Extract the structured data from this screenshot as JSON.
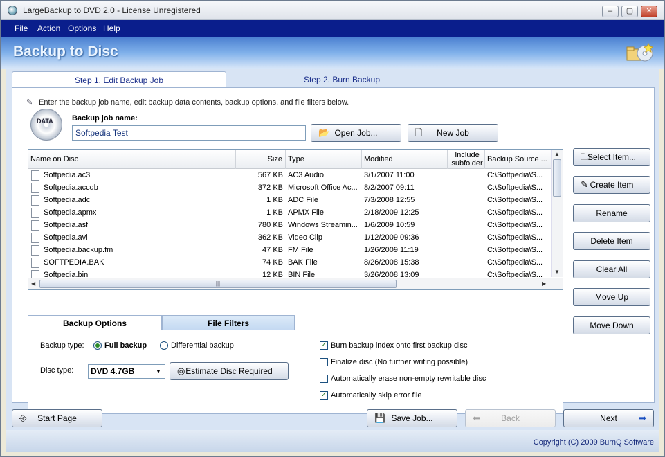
{
  "window": {
    "title": "LargeBackup to DVD 2.0 - License Unregistered",
    "min": "–",
    "max": "▢",
    "close": "✕"
  },
  "menu": [
    "File",
    "Action",
    "Options",
    "Help"
  ],
  "header": {
    "title": "Backup to Disc"
  },
  "steps": {
    "step1": "Step 1. Edit Backup Job",
    "step2": "Step 2. Burn Backup"
  },
  "hint": "Enter the backup job name, edit backup data contents, backup options, and file filters below.",
  "job": {
    "logo_text": "DATA",
    "label": "Backup job name:",
    "value": "Softpedia Test",
    "open_label": "Open Job...",
    "new_label": "New Job"
  },
  "list": {
    "columns": [
      "Name on Disc",
      "Size",
      "Type",
      "Modified",
      "Include subfolder",
      "Backup Source ..."
    ],
    "rows": [
      {
        "name": "Softpedia.ac3",
        "size": "567 KB",
        "type": "AC3 Audio",
        "modified": "3/1/2007 11:00",
        "source": "C:\\Softpedia\\S..."
      },
      {
        "name": "Softpedia.accdb",
        "size": "372 KB",
        "type": "Microsoft Office Ac...",
        "modified": "8/2/2007 09:11",
        "source": "C:\\Softpedia\\S..."
      },
      {
        "name": "Softpedia.adc",
        "size": "1 KB",
        "type": "ADC File",
        "modified": "7/3/2008 12:55",
        "source": "C:\\Softpedia\\S..."
      },
      {
        "name": "Softpedia.apmx",
        "size": "1 KB",
        "type": "APMX File",
        "modified": "2/18/2009 12:25",
        "source": "C:\\Softpedia\\S..."
      },
      {
        "name": "Softpedia.asf",
        "size": "780 KB",
        "type": "Windows Streamin...",
        "modified": "1/6/2009 10:59",
        "source": "C:\\Softpedia\\S..."
      },
      {
        "name": "Softpedia.avi",
        "size": "362 KB",
        "type": "Video Clip",
        "modified": "1/12/2009 09:36",
        "source": "C:\\Softpedia\\S..."
      },
      {
        "name": "Softpedia.backup.fm",
        "size": "47 KB",
        "type": "FM File",
        "modified": "1/26/2009 11:19",
        "source": "C:\\Softpedia\\S..."
      },
      {
        "name": "SOFTPEDIA.BAK",
        "size": "74 KB",
        "type": "BAK File",
        "modified": "8/26/2008 15:38",
        "source": "C:\\Softpedia\\S..."
      },
      {
        "name": "Softpedia.bin",
        "size": "12 KB",
        "type": "BIN File",
        "modified": "3/26/2008 13:09",
        "source": "C:\\Softpedia\\S..."
      }
    ]
  },
  "side": [
    "Select Item...",
    "Create Item",
    "Rename",
    "Delete Item",
    "Clear All",
    "Move Up",
    "Move Down"
  ],
  "options": {
    "tab_backup": "Backup Options",
    "tab_filters": "File Filters",
    "backup_type_label": "Backup type:",
    "full": "Full backup",
    "differential": "Differential backup",
    "disc_type_label": "Disc type:",
    "disc_value": "DVD 4.7GB",
    "estimate": "Estimate Disc Required",
    "checks": [
      {
        "label": "Burn backup index onto first backup disc",
        "checked": true
      },
      {
        "label": "Finalize disc (No further writing possible)",
        "checked": false
      },
      {
        "label": "Automatically erase non-empty rewritable disc",
        "checked": false
      },
      {
        "label": "Automatically skip error file",
        "checked": true
      }
    ]
  },
  "footer": {
    "start": "Start Page",
    "save": "Save Job...",
    "back": "Back",
    "next": "Next"
  },
  "status": "Copyright (C) 2009 BurnQ Software"
}
